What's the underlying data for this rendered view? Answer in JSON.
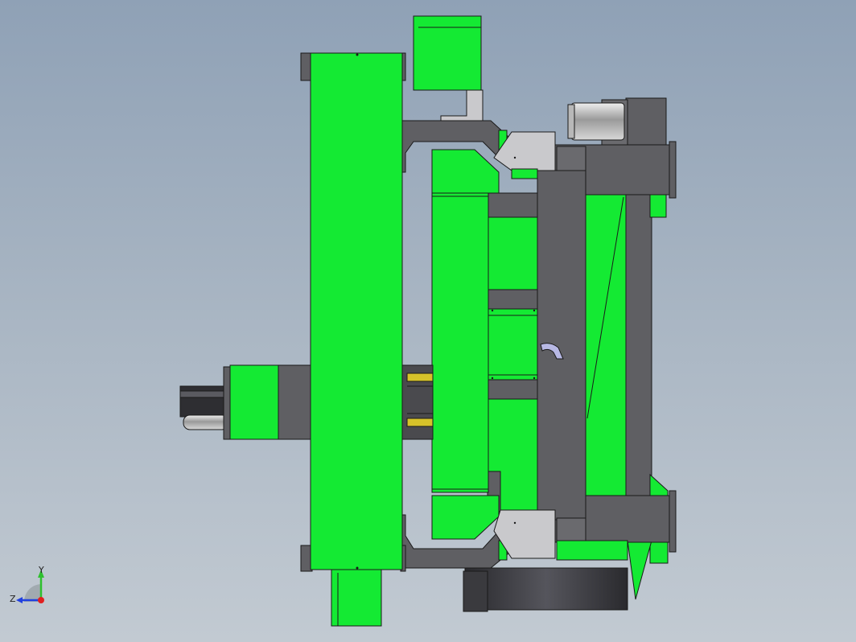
{
  "viewport": {
    "background_top": "#8fa1b6",
    "background_bottom": "#c2cad2"
  },
  "model": {
    "colors": {
      "green": "#14ea33",
      "dark_steel": "#5f5f63",
      "light_steel": "#c9c9cc",
      "yellow": "#d6c22a",
      "outline": "#1a1a1a"
    }
  },
  "triad": {
    "y_label": "Y",
    "z_label": "Z",
    "y_color": "#2ec02e",
    "x_color": "#e02020",
    "z_color": "#2040e0"
  }
}
